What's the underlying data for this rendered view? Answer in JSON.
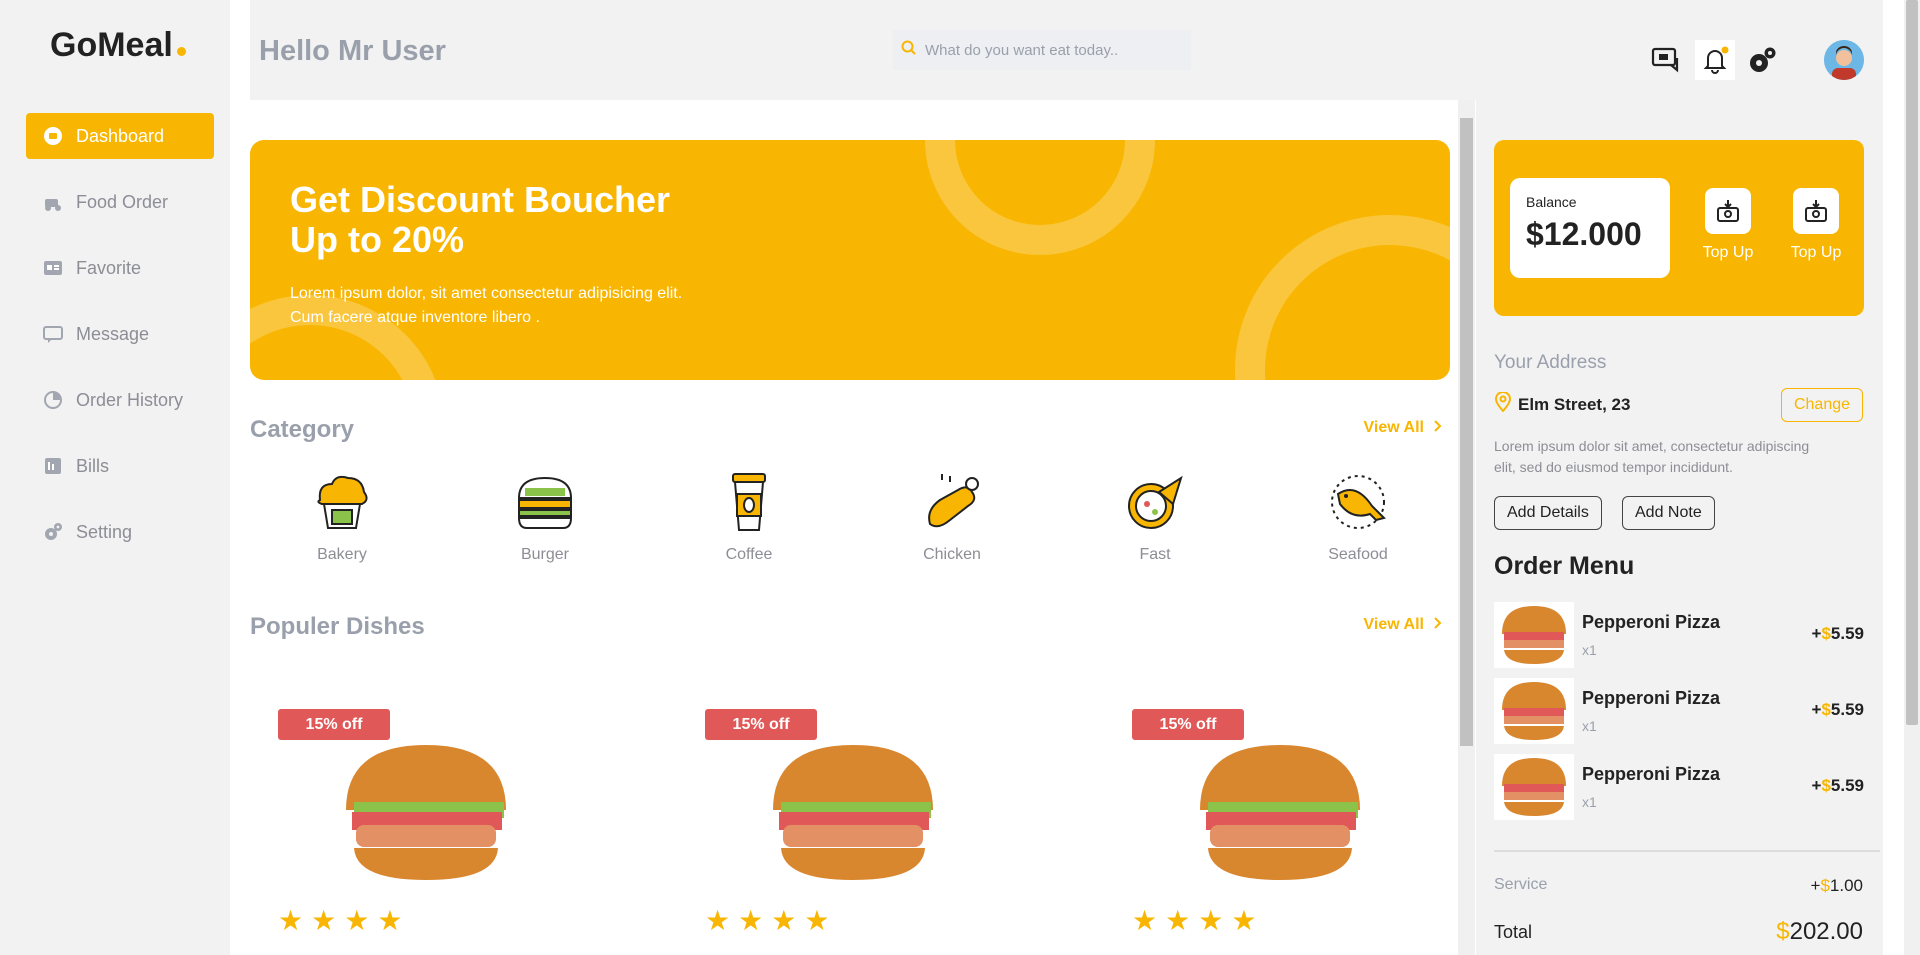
{
  "brand": {
    "name": "GoMeal",
    "accent": "#f8b602"
  },
  "sidebar": {
    "items": [
      {
        "label": "Dashboard",
        "icon": "dashboard-icon",
        "active": true
      },
      {
        "label": "Food Order",
        "icon": "food-order-icon"
      },
      {
        "label": "Favorite",
        "icon": "favorite-icon"
      },
      {
        "label": "Message",
        "icon": "message-icon"
      },
      {
        "label": "Order History",
        "icon": "order-history-icon"
      },
      {
        "label": "Bills",
        "icon": "bills-icon"
      },
      {
        "label": "Setting",
        "icon": "setting-icon"
      }
    ]
  },
  "header": {
    "greeting": "Hello Mr User",
    "search_placeholder": "What do you want eat today.."
  },
  "banner": {
    "title": "Get Discount Boucher Up to 20%",
    "text": "Lorem ipsum dolor, sit amet consectetur adipisicing elit. Cum facere atque inventore libero ."
  },
  "category": {
    "title": "Category",
    "view_all": "View All",
    "items": [
      "Bakery",
      "Burger",
      "Coffee",
      "Chicken",
      "Fast",
      "Seafood"
    ]
  },
  "dishes": {
    "title": "Populer Dishes",
    "view_all": "View All",
    "items": [
      {
        "badge": "15% off",
        "rating": 4
      },
      {
        "badge": "15% off",
        "rating": 4
      },
      {
        "badge": "15% off",
        "rating": 4
      }
    ]
  },
  "wallet": {
    "balance_label": "Balance",
    "balance_value": "$12.000",
    "topup_label_1": "Top Up",
    "topup_label_2": "Top Up"
  },
  "address": {
    "title": "Your Address",
    "street": "Elm Street, 23",
    "change_label": "Change",
    "description": "Lorem ipsum dolor sit amet, consectetur adipiscing elit, sed do eiusmod tempor incididunt.",
    "add_details_label": "Add Details",
    "add_note_label": "Add Note"
  },
  "order": {
    "title": "Order Menu",
    "items": [
      {
        "name": "Pepperoni Pizza",
        "qty": "x1",
        "sign": "+",
        "currency": "$",
        "price": "5.59"
      },
      {
        "name": "Pepperoni Pizza",
        "qty": "x1",
        "sign": "+",
        "currency": "$",
        "price": "5.59"
      },
      {
        "name": "Pepperoni Pizza",
        "qty": "x1",
        "sign": "+",
        "currency": "$",
        "price": "5.59"
      }
    ],
    "service_label": "Service",
    "service_sign": "+",
    "service_currency": "$",
    "service_value": "1.00",
    "total_label": "Total",
    "total_currency": "$",
    "total_value": "202.00"
  }
}
